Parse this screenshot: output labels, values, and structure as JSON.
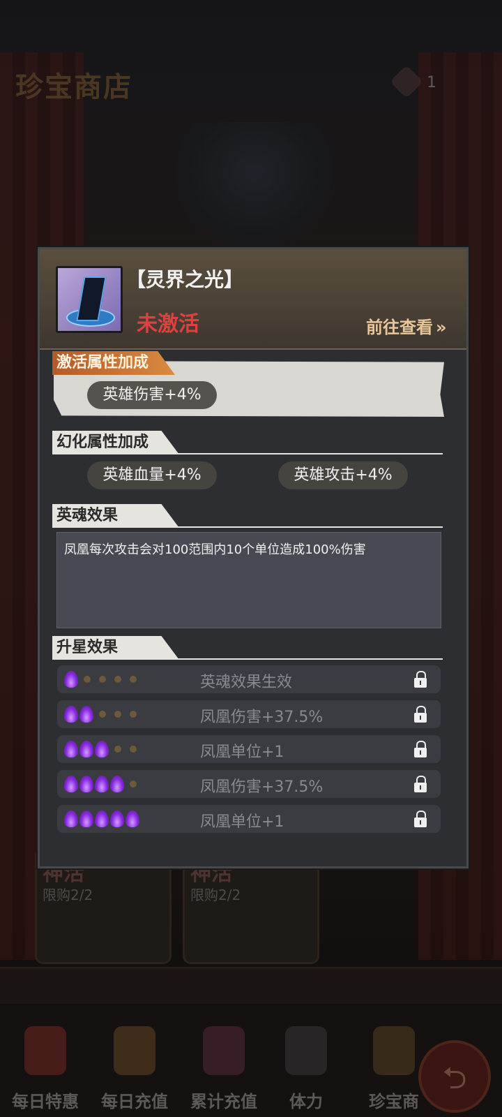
{
  "background": {
    "shop_title": "珍宝商店",
    "gem_count": "1",
    "cards": [
      {
        "tag": "神活",
        "limit": "限购2/2"
      },
      {
        "tag": "神活",
        "limit": "限购2/2"
      }
    ]
  },
  "bottom_nav": {
    "items": [
      {
        "label": "每日特惠",
        "icon": "gift-icon"
      },
      {
        "label": "每日充值",
        "icon": "money-bag-icon"
      },
      {
        "label": "累计充值",
        "icon": "treasure-bag-icon"
      },
      {
        "label": "体力",
        "icon": "lightning-icon"
      },
      {
        "label": "珍宝商",
        "icon": "shop-icon"
      }
    ],
    "back_icon": "back-arrow-icon"
  },
  "modal": {
    "item_name": "【灵界之光】",
    "status": "未激活",
    "goto_label": "前往查看",
    "goto_chevron": "»",
    "sections": {
      "activate": {
        "title": "激活属性加成",
        "bonuses": [
          "英雄伤害+4%"
        ]
      },
      "illusion": {
        "title": "幻化属性加成",
        "bonuses": [
          "英雄血量+4%",
          "英雄攻击+4%"
        ]
      },
      "soul": {
        "title": "英魂效果",
        "description": "凤凰每次攻击会对100范围内10个单位造成100%伤害"
      },
      "star": {
        "title": "升星效果",
        "rows": [
          {
            "stars": 1,
            "text": "英魂效果生效",
            "locked": true
          },
          {
            "stars": 2,
            "text": "凤凰伤害+37.5%",
            "locked": true
          },
          {
            "stars": 3,
            "text": "凤凰单位+1",
            "locked": true
          },
          {
            "stars": 4,
            "text": "凤凰伤害+37.5%",
            "locked": true
          },
          {
            "stars": 5,
            "text": "凤凰单位+1",
            "locked": true
          }
        ]
      }
    }
  },
  "colors": {
    "status_inactive": "#e04040",
    "goto_link": "#e8c69a",
    "flame_purple": "#8a2be2"
  }
}
